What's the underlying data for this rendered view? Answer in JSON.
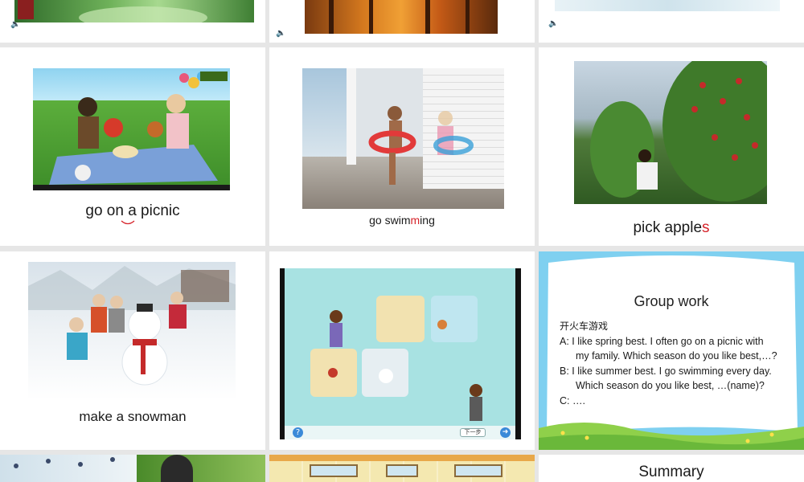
{
  "slides": {
    "picnic": {
      "caption": "go on a picnic"
    },
    "swimming": {
      "caption_main": "go swim",
      "caption_red": "m",
      "caption_end": "ing"
    },
    "apples": {
      "caption_main": "pick apple",
      "caption_red": "s"
    },
    "snowman": {
      "caption": "make a snowman"
    },
    "game": {
      "next_label": "下一步",
      "help_label": "?"
    },
    "group_work": {
      "title": "Group work",
      "subtitle": "开火车游戏",
      "line_a1": "A:   I like spring best. I often go on a picnic with",
      "line_a2": "my family. Which season do you like best,…?",
      "line_b1": "B:   I like summer best. I go swimming every day.",
      "line_b2": "Which season do you like best, …(name)?",
      "line_c": "C: …."
    },
    "summary": {
      "title": "Summary"
    }
  },
  "colors": {
    "accent_red": "#d6232a",
    "slide_bg": "#ffffff",
    "sorter_bg": "#e6e6e6",
    "game_bg": "#a8e2e2"
  },
  "icons": [
    "speaker-icon",
    "help-icon",
    "next-button",
    "arrow-right-icon"
  ]
}
